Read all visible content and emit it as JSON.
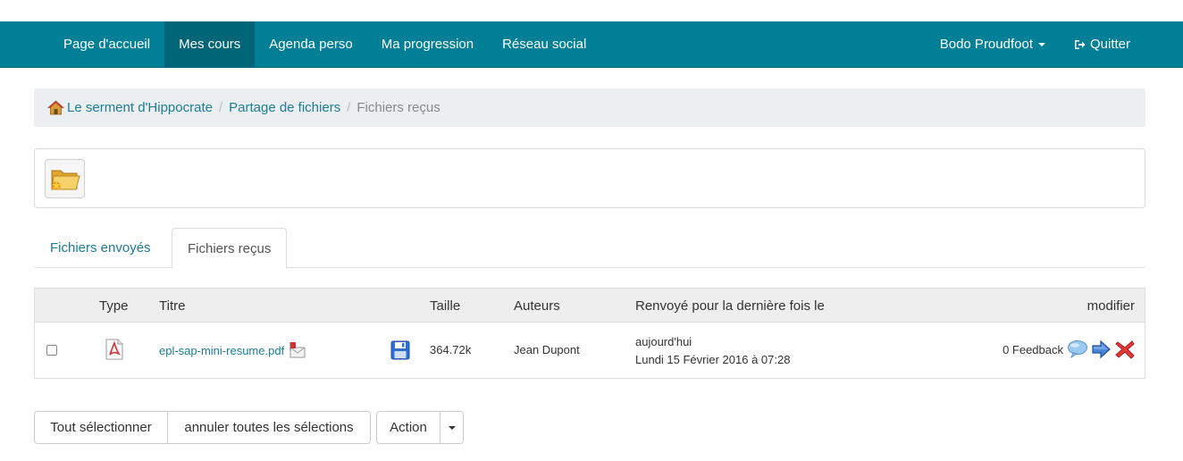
{
  "navbar": {
    "items": [
      {
        "label": "Page d'accueil",
        "active": false
      },
      {
        "label": "Mes cours",
        "active": true
      },
      {
        "label": "Agenda perso",
        "active": false
      },
      {
        "label": "Ma progression",
        "active": false
      },
      {
        "label": "Réseau social",
        "active": false
      }
    ],
    "user_label": "Bodo Proudfoot",
    "logout_label": "Quitter",
    "bg_color": "#007f96"
  },
  "breadcrumb": {
    "course": "Le serment d'Hippocrate",
    "section": "Partage de fichiers",
    "current": "Fichiers reçus"
  },
  "toolbar": {
    "icon": "folder-new-icon"
  },
  "tabs": {
    "sent": "Fichiers envoyés",
    "received": "Fichiers reçus",
    "active": "received"
  },
  "table": {
    "headers": {
      "type": "Type",
      "title": "Titre",
      "size": "Taille",
      "authors": "Auteurs",
      "last_sent": "Renvoyé pour la dernière fois le",
      "modify": "modifier"
    },
    "rows": [
      {
        "checked": false,
        "type_icon": "pdf-icon",
        "title": "epl-sap-mini-resume.pdf",
        "size": "364.72k",
        "author": "Jean Dupont",
        "date_relative": "aujourd'hui",
        "date_full": "Lundi 15 Février 2016 à 07:28",
        "feedback": "0 Feedback"
      }
    ]
  },
  "buttons": {
    "select_all": "Tout sélectionner",
    "deselect_all": "annuler toutes les sélections",
    "action": "Action"
  }
}
